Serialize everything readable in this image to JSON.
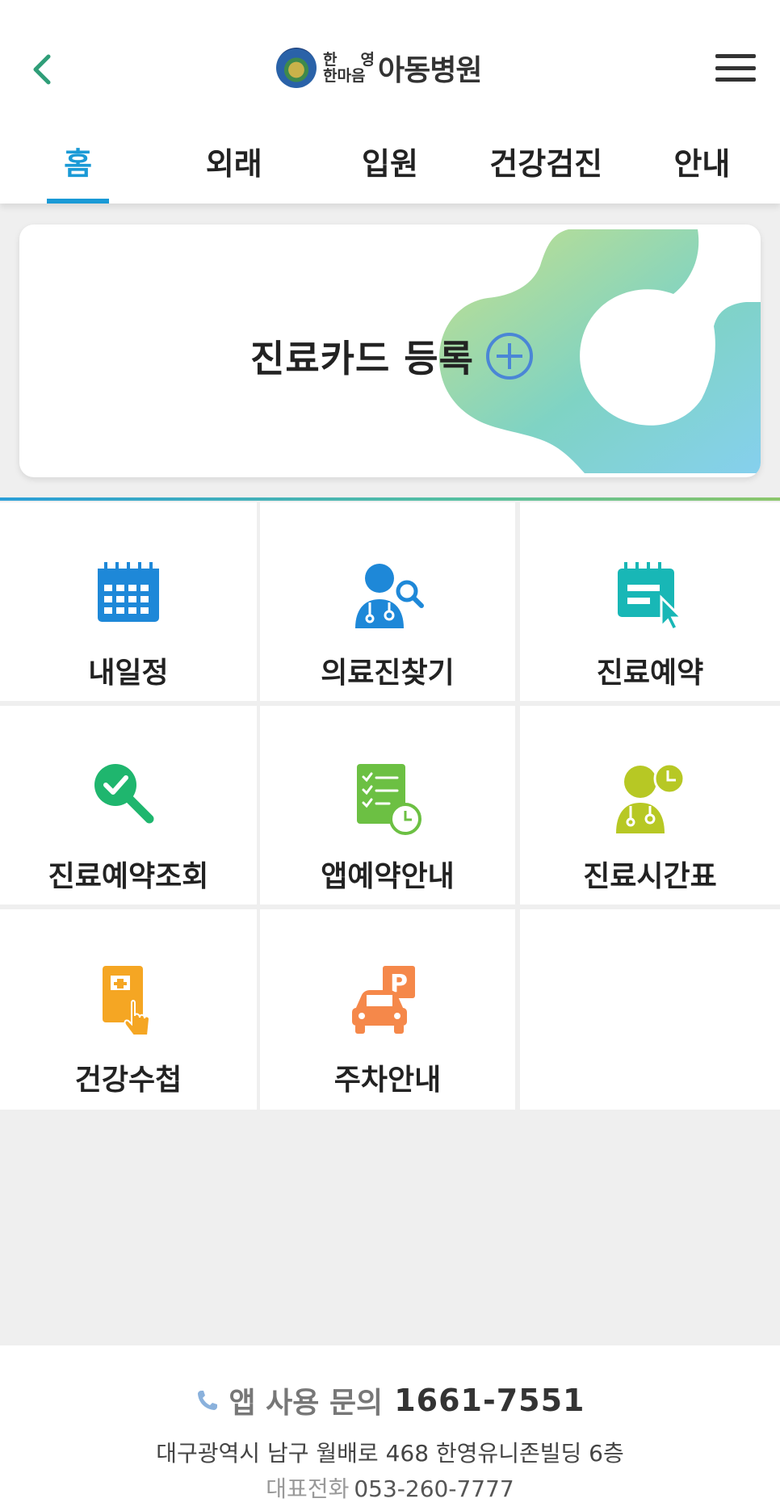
{
  "header": {
    "logo": {
      "sub_top_left": "한",
      "sub_top_right": "영",
      "sub_bottom": "한마음",
      "main": "아동병원"
    }
  },
  "tabs": [
    {
      "label": "홈",
      "active": true
    },
    {
      "label": "외래",
      "active": false
    },
    {
      "label": "입원",
      "active": false
    },
    {
      "label": "건강검진",
      "active": false
    },
    {
      "label": "안내",
      "active": false
    }
  ],
  "card": {
    "label": "진료카드 등록"
  },
  "menu": [
    {
      "label": "내일정",
      "icon": "calendar-icon",
      "color": "#1e88d8"
    },
    {
      "label": "의료진찾기",
      "icon": "doctor-search-icon",
      "color": "#1e88d8"
    },
    {
      "label": "진료예약",
      "icon": "reservation-click-icon",
      "color": "#18b7b6"
    },
    {
      "label": "진료예약조회",
      "icon": "check-search-icon",
      "color": "#1fb66e"
    },
    {
      "label": "앱예약안내",
      "icon": "checklist-clock-icon",
      "color": "#6cc043"
    },
    {
      "label": "진료시간표",
      "icon": "doctor-clock-icon",
      "color": "#b7c824"
    },
    {
      "label": "건강수첩",
      "icon": "health-notebook-icon",
      "color": "#f5a623"
    },
    {
      "label": "주차안내",
      "icon": "parking-car-icon",
      "color": "#f5884a"
    }
  ],
  "footer": {
    "inquiry_label": "앱 사용 문의",
    "inquiry_number": "1661-7551",
    "address": "대구광역시 남구 월배로 468 한영유니존빌딩 6층",
    "tel_label": "대표전화",
    "tel_number": "053-260-7777"
  },
  "colors": {
    "accent": "#1a9ad6",
    "back_arrow": "#2f9e78"
  }
}
